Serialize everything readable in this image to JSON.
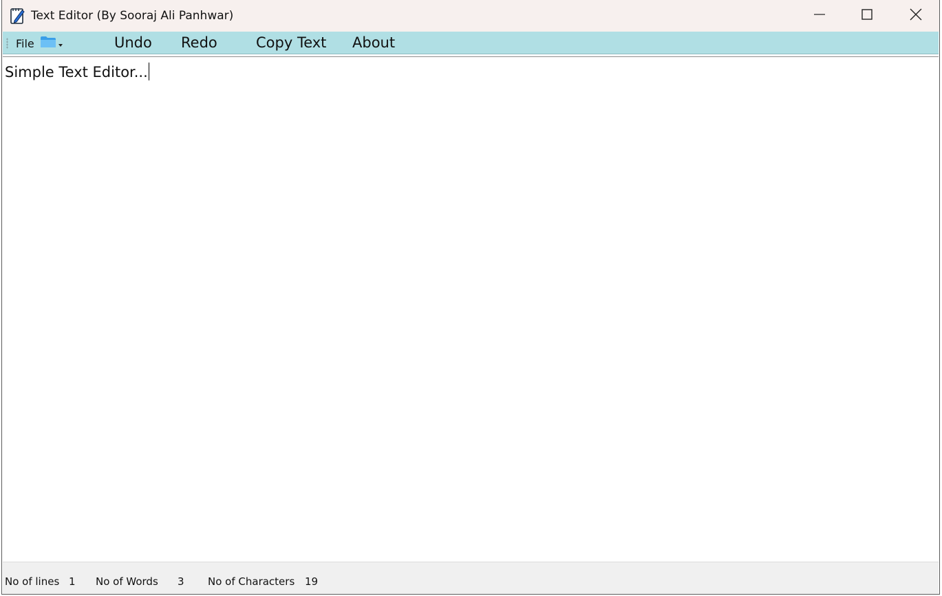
{
  "window": {
    "title": "Text Editor (By Sooraj Ali Panhwar)",
    "app_icon": "notepad-pencil-icon",
    "controls": [
      "minimize-icon",
      "maximize-icon",
      "close-icon"
    ]
  },
  "toolbar": {
    "file_label": "File",
    "folder_icon": "folder-dropdown-icon",
    "undo_label": "Undo",
    "redo_label": "Redo",
    "copy_label": "Copy Text",
    "about_label": "About",
    "background_color": "#b0dfe4"
  },
  "editor": {
    "content": "Simple Text Editor..."
  },
  "statusbar": {
    "lines_label": "No of lines",
    "lines_value": "1",
    "words_label": "No of Words",
    "words_value": "3",
    "chars_label": "No of Characters",
    "chars_value": "19"
  }
}
